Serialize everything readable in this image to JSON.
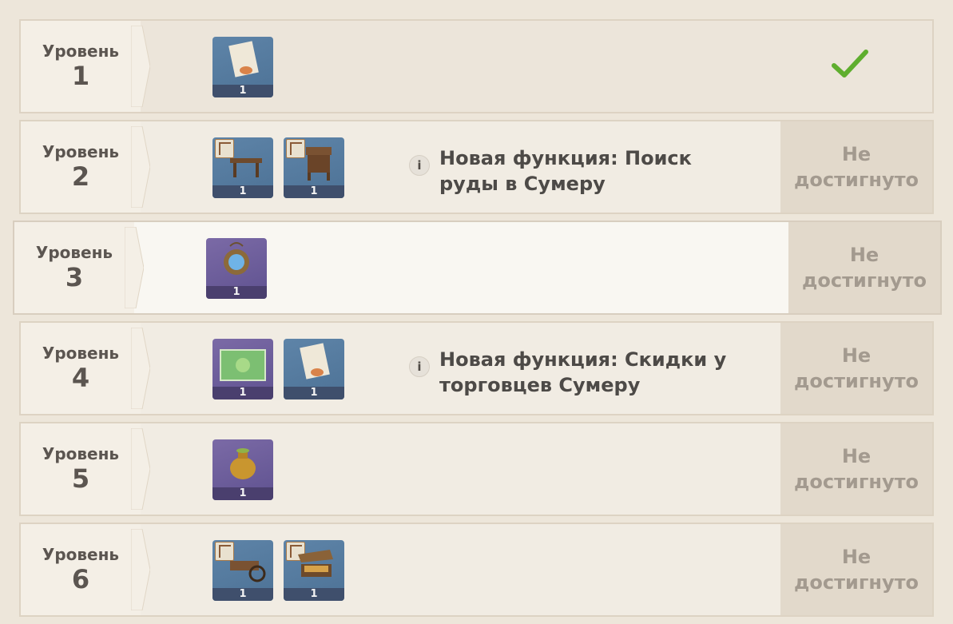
{
  "rows": [
    {
      "level_word": "Уровень",
      "level_num": "1",
      "items": [
        {
          "icon": "recipe-scroll-icon",
          "qty": "1"
        }
      ],
      "info": "",
      "status": "",
      "completed": true
    },
    {
      "level_word": "Уровень",
      "level_num": "2",
      "items": [
        {
          "icon": "workbench-blueprint-icon",
          "qty": "1"
        },
        {
          "icon": "stand-blueprint-icon",
          "qty": "1"
        }
      ],
      "info": "Новая функция: Поиск руды в Сумеру",
      "status": "Не достигнуто"
    },
    {
      "level_word": "Уровень",
      "level_num": "3",
      "items": [
        {
          "icon": "blue-gem-amulet-icon",
          "qty": "1"
        }
      ],
      "info": "",
      "status": "Не достигнуто"
    },
    {
      "level_word": "Уровень",
      "level_num": "4",
      "items": [
        {
          "icon": "green-flower-card-icon",
          "qty": "1"
        },
        {
          "icon": "recipe-scroll-icon",
          "qty": "1"
        }
      ],
      "info": "Новая функция: Скидки у торговцев Сумеру",
      "status": "Не достигнуто"
    },
    {
      "level_word": "Уровень",
      "level_num": "5",
      "items": [
        {
          "icon": "golden-vase-icon",
          "qty": "1"
        }
      ],
      "info": "",
      "status": "Не достигнуто"
    },
    {
      "level_word": "Уровень",
      "level_num": "6",
      "items": [
        {
          "icon": "cart-blueprint-icon",
          "qty": "1"
        },
        {
          "icon": "market-stall-blueprint-icon",
          "qty": "1"
        }
      ],
      "info": "",
      "status": "Не достигнуто"
    }
  ]
}
